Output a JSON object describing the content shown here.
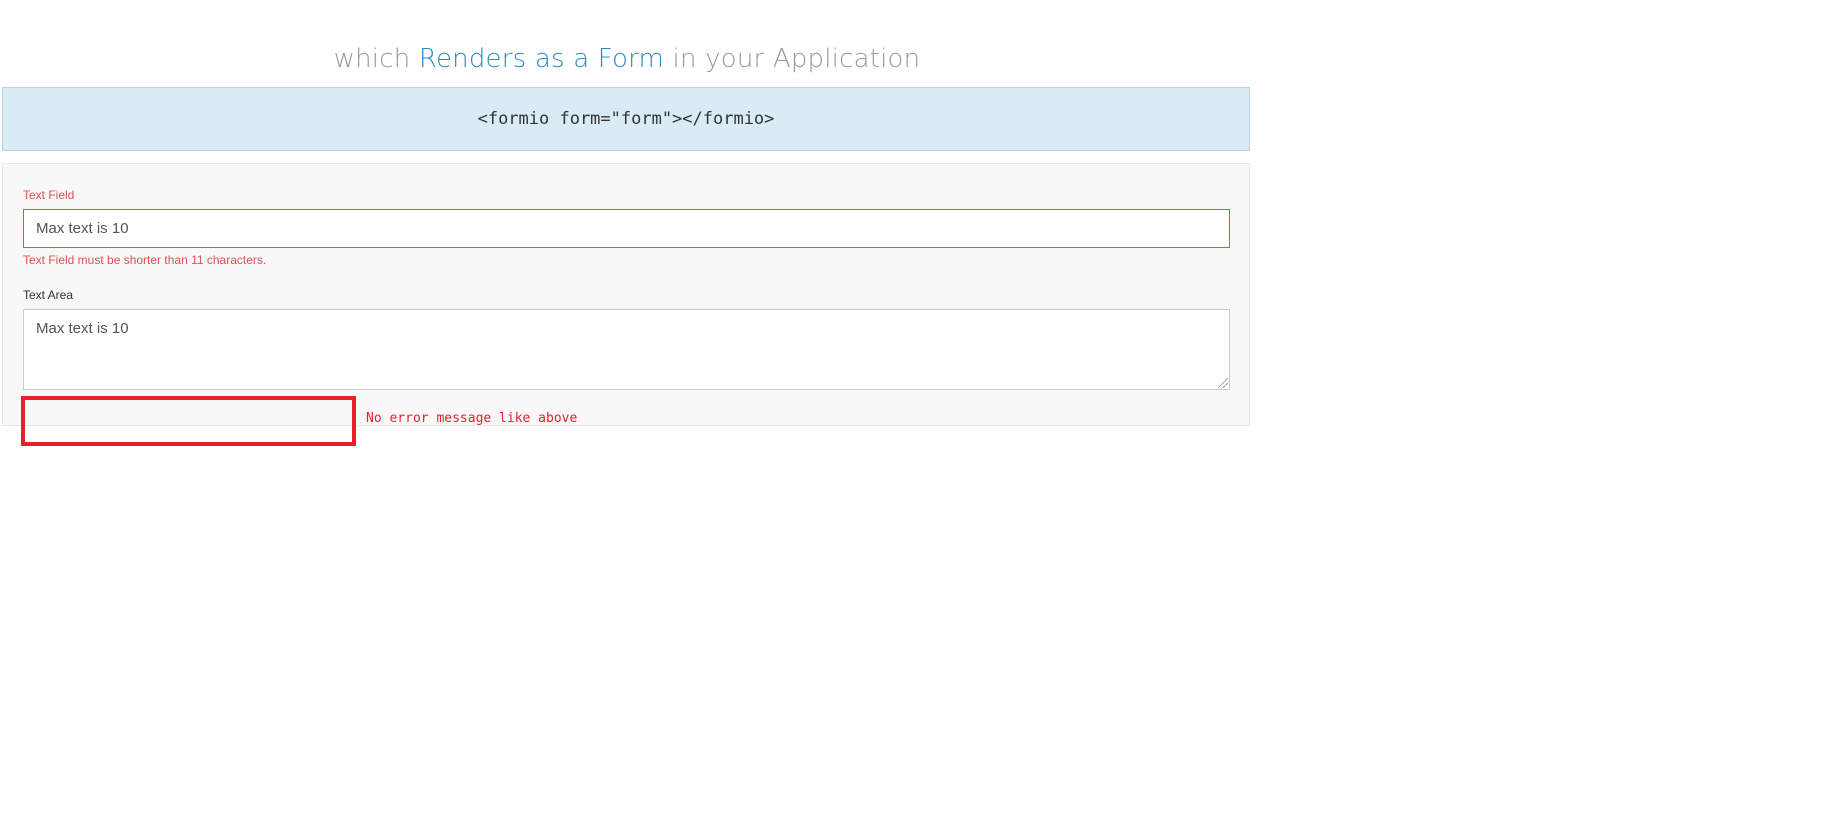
{
  "heading": {
    "prefix": "which ",
    "highlight": "Renders as a Form",
    "suffix": " in your Application"
  },
  "code_snippet": "<formio form=\"form\"></formio>",
  "form": {
    "text_field": {
      "label": "Text Field",
      "value": "Max text is 10",
      "error": "Text Field must be shorter than 11 characters."
    },
    "text_area": {
      "label": "Text Area",
      "value": "Max text is 10"
    }
  },
  "annotation": {
    "note": "No error message like above"
  },
  "colors": {
    "accent": "#2a8bbd",
    "error": "#d9534f",
    "annotation": "#e8202a",
    "code_bg": "#d9ebf5"
  }
}
